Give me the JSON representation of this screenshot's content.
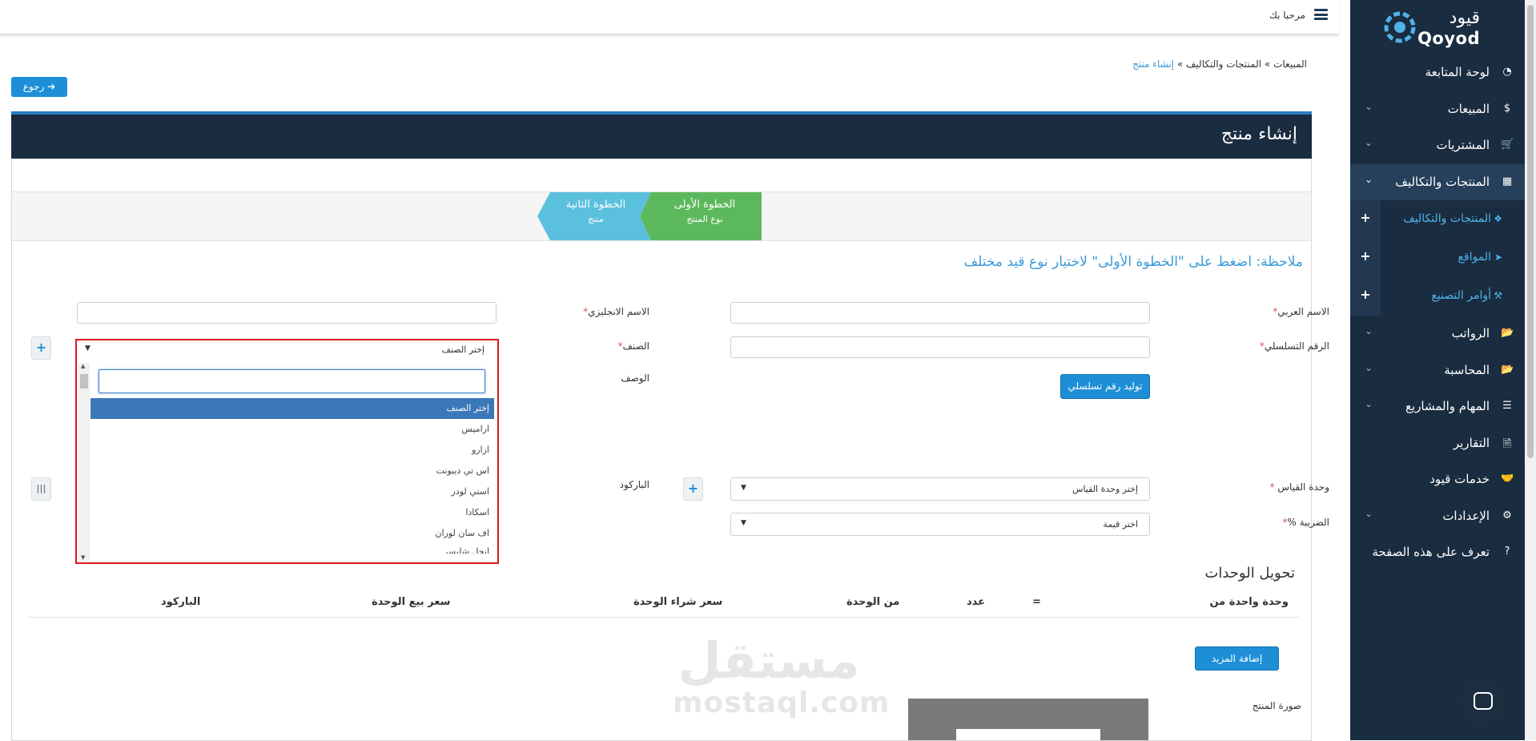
{
  "topbar": {
    "welcome": "مرحبا بك"
  },
  "logo": {
    "arabic": "قيود",
    "english": "Qoyod"
  },
  "sidebar": {
    "items": [
      {
        "label": "لوحة المتابعة",
        "icon": "dashboard-icon",
        "glyph": "◔"
      },
      {
        "label": "المبيعات",
        "icon": "dollar-icon",
        "glyph": "$"
      },
      {
        "label": "المشتريات",
        "icon": "cart-icon",
        "glyph": "🛒"
      },
      {
        "label": "المنتجات والتكاليف",
        "icon": "grid-icon",
        "glyph": "▦"
      }
    ],
    "subitems": [
      {
        "label": "المنتجات والتكاليف",
        "icon": "cubes-icon",
        "glyph": "❖",
        "plus": "+"
      },
      {
        "label": "المواقع",
        "icon": "location-arrow-icon",
        "glyph": "➤",
        "plus": "+"
      },
      {
        "label": "أوامر التصنيع",
        "icon": "factory-icon",
        "glyph": "⚒",
        "plus": "+"
      }
    ],
    "items2": [
      {
        "label": "الرواتب",
        "icon": "folder-icon",
        "glyph": "📂"
      },
      {
        "label": "المحاسبة",
        "icon": "folder-open-icon",
        "glyph": "📂"
      },
      {
        "label": "المهام والمشاريع",
        "icon": "list-icon",
        "glyph": "☰"
      },
      {
        "label": "التقارير",
        "icon": "file-icon",
        "glyph": "🗎"
      },
      {
        "label": "خدمات قيود",
        "icon": "handshake-icon",
        "glyph": "🤝"
      },
      {
        "label": "الإعدادات",
        "icon": "gear-icon",
        "glyph": "⚙"
      },
      {
        "label": "تعرف على هذه الصفحة",
        "icon": "question-icon",
        "glyph": "?"
      }
    ]
  },
  "breadcrumb": {
    "item1": "المبيعات",
    "sep": "»",
    "item2": "المنتجات والتكاليف",
    "current": "إنشاء منتج"
  },
  "back_button": "رجوع",
  "page_title": "إنشاء منتج",
  "steps": {
    "step1": {
      "title": "الخطوة الأولى",
      "subtitle": "نوع المنتج",
      "color": "#5cb85c"
    },
    "step2": {
      "title": "الخطوة الثانية",
      "subtitle": "منتج",
      "color": "#5bc0de"
    }
  },
  "note": "ملاحظة: اضغط على \"الخطوة الأولى\" لاختيار نوع قيد مختلف",
  "form": {
    "arabic_name_label": "الاسم العربي",
    "english_name_label": "الاسم الانجليزي",
    "serial_label": "الرقم التسلسلي",
    "category_label": "الصنف",
    "description_label": "الوصف",
    "generate_serial": "توليد رقم تسلسلي",
    "unit_label": "وحدة القياس",
    "unit_value": "إختر وحدة القياس",
    "barcode_label": "الباركود",
    "tax_label": "الضريبة %",
    "tax_value": "اختر قيمة",
    "required": "*"
  },
  "category_dropdown": {
    "selected": "إختر الصنف",
    "options": [
      "إختر الصنف",
      "اراميس",
      "ازارو",
      "اس تي ديبونت",
      "استي لودر",
      "اسكادا",
      "اف سان لوران",
      "انجل شليسر"
    ]
  },
  "units": {
    "title": "تحويل الوحدات",
    "columns": [
      "وحدة واحدة من",
      "=",
      "عدد",
      "من الوحدة",
      "سعر شراء الوحدة",
      "سعر بيع الوحدة",
      "الباركود"
    ],
    "add_more": "إضافة المزيد"
  },
  "product_image_label": "صورة المنتج",
  "watermark": {
    "arabic": "مستقل",
    "latin": "mostaql.com"
  }
}
